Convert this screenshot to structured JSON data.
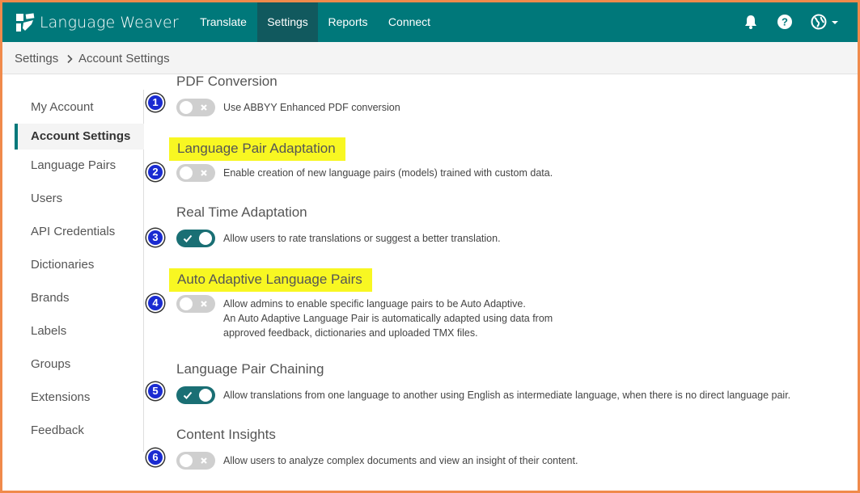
{
  "brand": {
    "name": "Language Weaver"
  },
  "nav": {
    "items": [
      {
        "label": "Translate",
        "active": false
      },
      {
        "label": "Settings",
        "active": true
      },
      {
        "label": "Reports",
        "active": false
      },
      {
        "label": "Connect",
        "active": false
      }
    ],
    "icons": [
      "bell-icon",
      "help-icon",
      "globe-icon",
      "chevron-down-icon"
    ]
  },
  "breadcrumb": {
    "items": [
      "Settings",
      "Account Settings"
    ],
    "separator_icon": "chevron-right-icon"
  },
  "sidebar": {
    "items": [
      {
        "label": "My Account",
        "active": false
      },
      {
        "label": "Account Settings",
        "active": true
      },
      {
        "label": "Language Pairs",
        "active": false
      },
      {
        "label": "Users",
        "active": false
      },
      {
        "label": "API Credentials",
        "active": false
      },
      {
        "label": "Dictionaries",
        "active": false
      },
      {
        "label": "Brands",
        "active": false
      },
      {
        "label": "Labels",
        "active": false
      },
      {
        "label": "Groups",
        "active": false
      },
      {
        "label": "Extensions",
        "active": false
      },
      {
        "label": "Feedback",
        "active": false
      }
    ]
  },
  "settings": [
    {
      "badge": "1",
      "title": "PDF Conversion",
      "highlighted": false,
      "enabled": false,
      "description": [
        "Use ABBYY Enhanced PDF conversion"
      ]
    },
    {
      "badge": "2",
      "title": "Language Pair Adaptation",
      "highlighted": true,
      "enabled": false,
      "description": [
        "Enable creation of new language pairs (models) trained with custom data."
      ]
    },
    {
      "badge": "3",
      "title": "Real Time Adaptation",
      "highlighted": false,
      "enabled": true,
      "description": [
        "Allow users to rate translations or suggest a better translation."
      ]
    },
    {
      "badge": "4",
      "title": "Auto Adaptive Language Pairs",
      "highlighted": true,
      "enabled": false,
      "description": [
        "Allow admins to enable specific language pairs to be Auto Adaptive.",
        "An Auto Adaptive Language Pair is automatically adapted using data from",
        "approved feedback, dictionaries and uploaded TMX files."
      ]
    },
    {
      "badge": "5",
      "title": "Language Pair Chaining",
      "highlighted": false,
      "enabled": true,
      "description": [
        "Allow translations from one language to another using English as intermediate language, when there is no direct language pair."
      ]
    },
    {
      "badge": "6",
      "title": "Content Insights",
      "highlighted": false,
      "enabled": false,
      "description": [
        "Allow users to analyze complex documents and view an insight of their content."
      ]
    }
  ],
  "colors": {
    "nav_bg": "#00787a",
    "nav_active": "#11595e",
    "toggle_on": "#1a6f74",
    "toggle_off": "#cfcfcf",
    "highlight": "#f8f722",
    "badge": "#1a2bd1",
    "frame_border": "#f08a4b"
  }
}
